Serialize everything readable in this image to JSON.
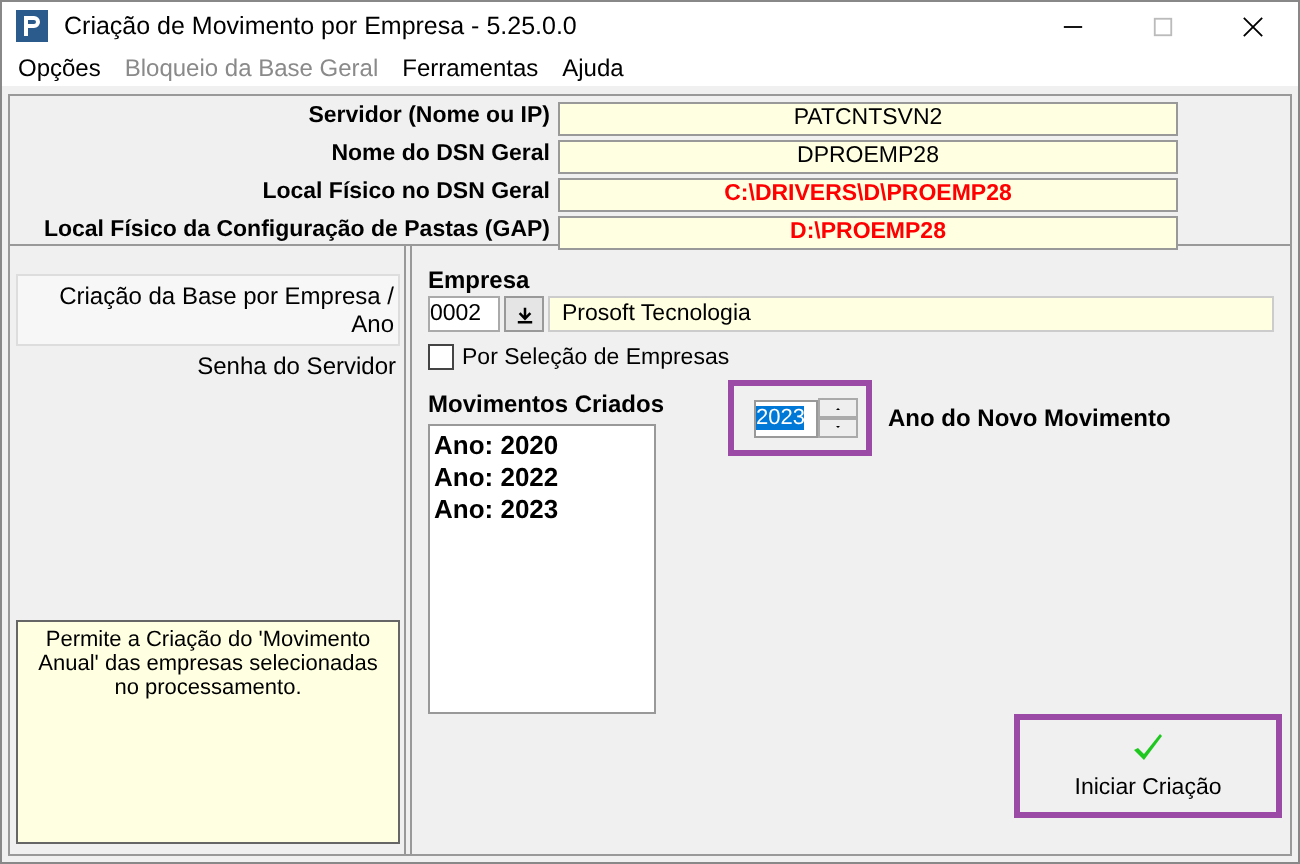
{
  "window": {
    "title": "Criação de Movimento por Empresa - 5.25.0.0"
  },
  "menu": [
    {
      "label": "Opções",
      "disabled": false
    },
    {
      "label": "Bloqueio da Base Geral",
      "disabled": true
    },
    {
      "label": "Ferramentas",
      "disabled": false
    },
    {
      "label": "Ajuda",
      "disabled": false
    }
  ],
  "info": [
    {
      "label": "Servidor (Nome ou IP)",
      "value": "PATCNTSVN2",
      "color": "#000000"
    },
    {
      "label": "Nome do DSN Geral",
      "value": "DPROEMP28",
      "color": "#000000"
    },
    {
      "label": "Local Físico no DSN Geral",
      "value": "C:\\DRIVERS\\D\\PROEMP28",
      "color": "#ff0000"
    },
    {
      "label": "Local Físico da Configuração de Pastas (GAP)",
      "value": "D:\\PROEMP28",
      "color": "#ff0000"
    }
  ],
  "sidebar": {
    "items": [
      {
        "label": "Criação da Base por Empresa / Ano",
        "selected": true
      },
      {
        "label": "Senha do Servidor",
        "selected": false
      }
    ],
    "description": "Permite a Criação do 'Movimento Anual' das empresas selecionadas no processamento."
  },
  "empresa": {
    "label": "Empresa",
    "code": "0002",
    "name": "Prosoft Tecnologia"
  },
  "selection_checkbox": {
    "label": "Por Seleção de Empresas",
    "checked": false
  },
  "movimentos": {
    "label": "Movimentos Criados",
    "items": [
      "Ano: 2020",
      "Ano: 2022",
      "Ano: 2023"
    ]
  },
  "ano": {
    "value": "2023",
    "label": "Ano do Novo Movimento",
    "highlighted": true
  },
  "start_button": {
    "label": "Iniciar Criação",
    "highlighted": true
  }
}
